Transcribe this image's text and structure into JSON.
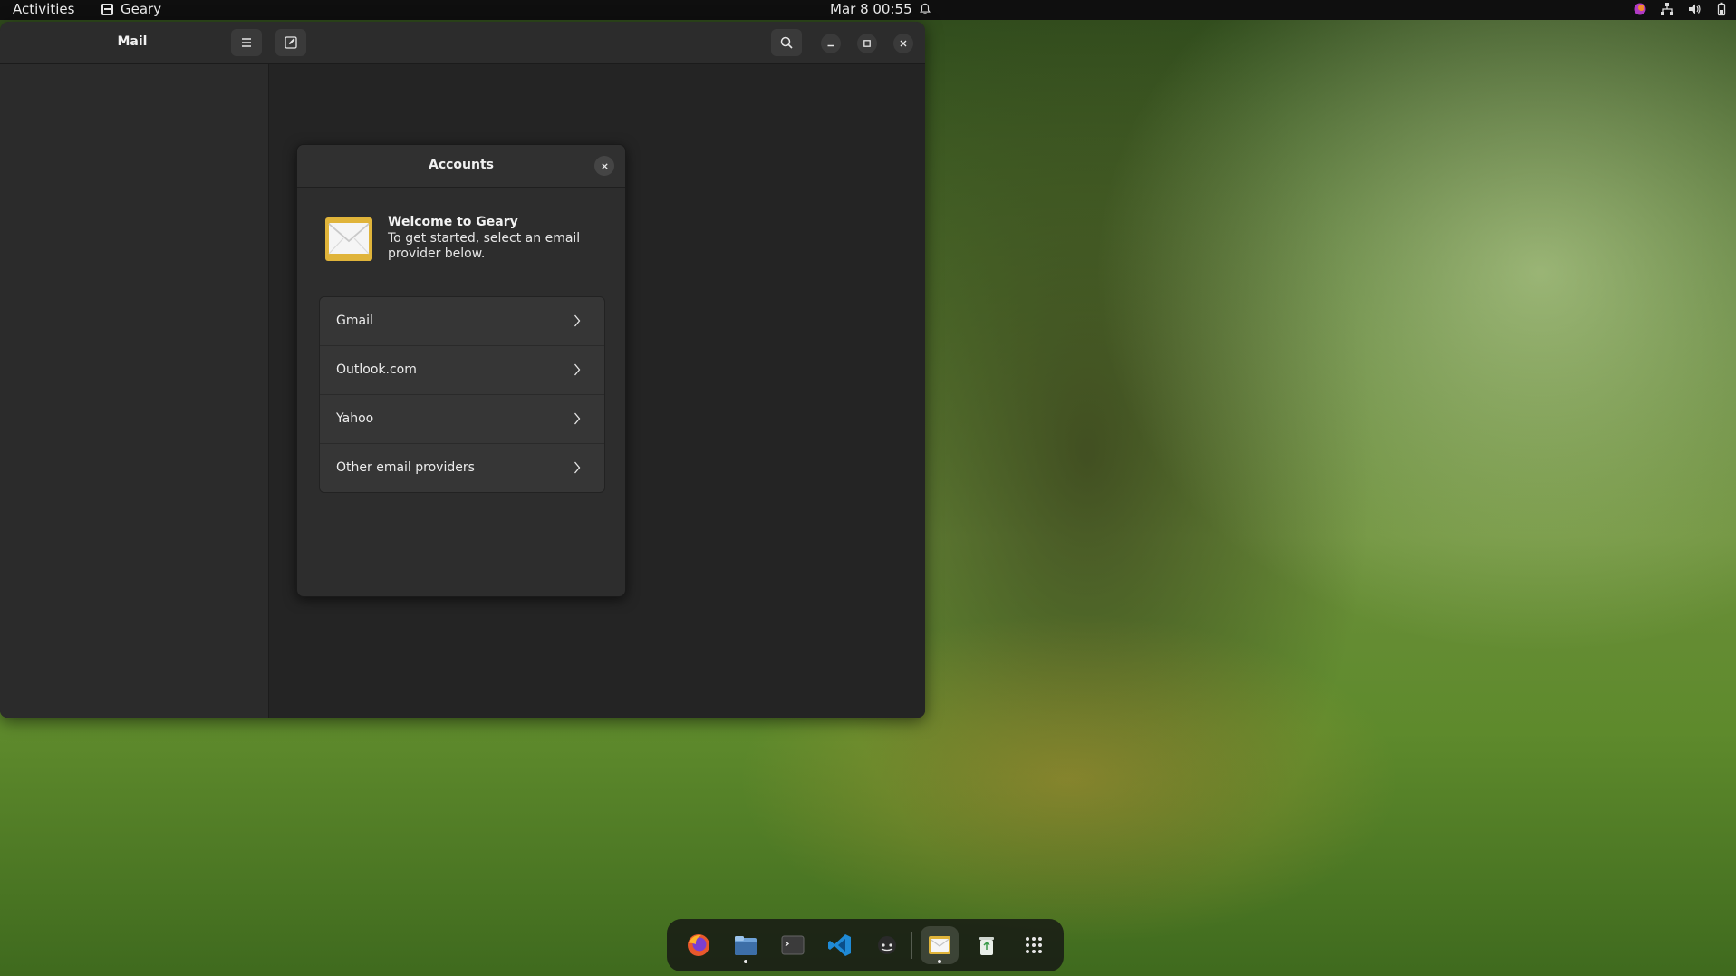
{
  "topbar": {
    "activities_label": "Activities",
    "app_name": "Geary",
    "clock": "Mar 8  00:55"
  },
  "window": {
    "title": "Mail"
  },
  "dialog": {
    "title": "Accounts",
    "welcome_title": "Welcome to Geary",
    "welcome_text": "To get started, select an email provider below.",
    "providers": [
      {
        "label": "Gmail"
      },
      {
        "label": "Outlook.com"
      },
      {
        "label": "Yahoo"
      },
      {
        "label": "Other email providers"
      }
    ]
  },
  "dock": {
    "items": [
      {
        "name": "firefox-icon",
        "running": false,
        "active": false
      },
      {
        "name": "files-icon",
        "running": true,
        "active": false
      },
      {
        "name": "terminal-icon",
        "running": false,
        "active": false
      },
      {
        "name": "vscode-icon",
        "running": false,
        "active": false
      },
      {
        "name": "app-icon",
        "running": false,
        "active": false
      },
      {
        "name": "geary-mail-icon",
        "running": true,
        "active": true
      },
      {
        "name": "trash-icon",
        "running": false,
        "active": false
      },
      {
        "name": "show-apps-icon",
        "running": false,
        "active": false
      }
    ]
  },
  "colors": {
    "accent": "#e0b43a",
    "window_bg": "#242424",
    "sidebar_bg": "#2b2b2b",
    "topbar_bg": "#0f0f0f"
  }
}
